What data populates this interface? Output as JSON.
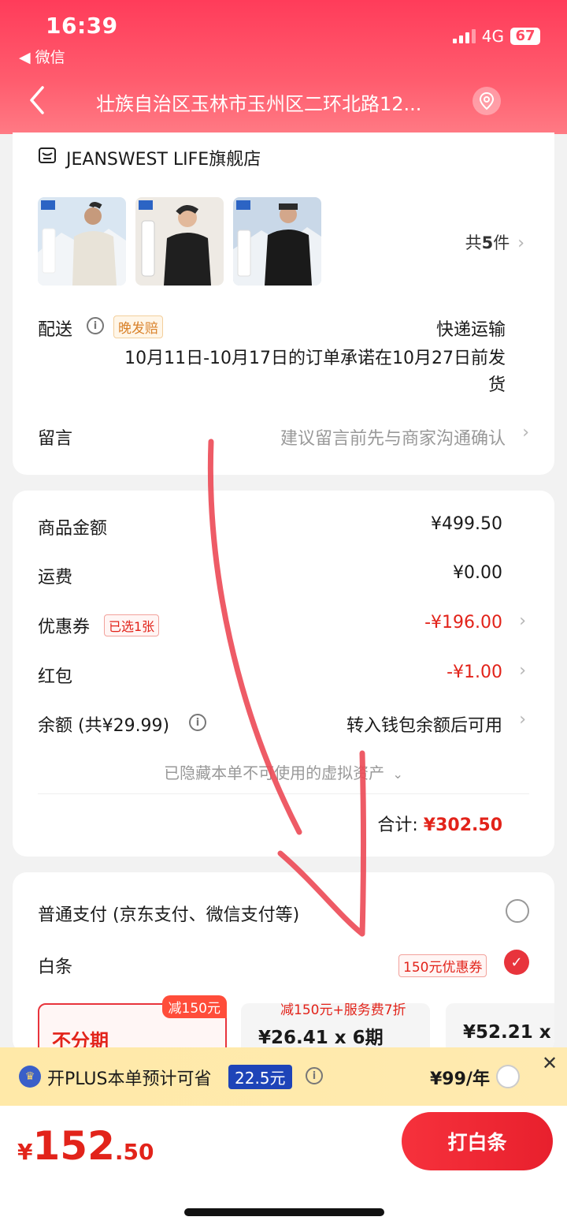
{
  "status": {
    "time": "16:39",
    "back_app": "◀ 微信",
    "network": "4G",
    "battery": "67"
  },
  "nav": {
    "title": "壮族自治区玉林市玉州区二环北路12..."
  },
  "store": {
    "name": "JEANSWEST LIFE旗舰店",
    "count_prefix": "共",
    "count_num": "5",
    "count_suffix": "件"
  },
  "delivery": {
    "label": "配送",
    "tag": "晚发赔",
    "method": "快递运输",
    "promise_line1": "10月11日-10月17日的订单承诺在10月27日前发",
    "promise_line2": "货"
  },
  "remark": {
    "label": "留言",
    "placeholder": "建议留言前先与商家沟通确认"
  },
  "summary": {
    "goods_label": "商品金额",
    "goods_value": "¥499.50",
    "shipping_label": "运费",
    "shipping_value": "¥0.00",
    "coupon_label": "优惠券",
    "coupon_tag": "已选1张",
    "coupon_value": "-¥196.00",
    "redpacket_label": "红包",
    "redpacket_value": "-¥1.00",
    "balance_label": "余额 (共¥29.99)",
    "balance_value": "转入钱包余额后可用",
    "hidden_note": "已隐藏本单不可使用的虚拟资产",
    "total_label": "合计:",
    "total_value": "¥302.50"
  },
  "payment": {
    "normal_label": "普通支付 (京东支付、微信支付等)",
    "baitiao_label": "白条",
    "baitiao_tag": "150元优惠券",
    "plans": [
      {
        "badge": "减150元",
        "title": "不分期"
      },
      {
        "sub": "减150元+服务费7折",
        "value": "¥26.41 x 6期"
      },
      {
        "value": "¥52.21 x"
      }
    ]
  },
  "plus": {
    "text": "开PLUS本单预计可省",
    "save": "22.5元",
    "price": "¥99/年"
  },
  "bottom": {
    "yen": "¥",
    "int": "152",
    "dec": ".50",
    "button": "打白条"
  }
}
